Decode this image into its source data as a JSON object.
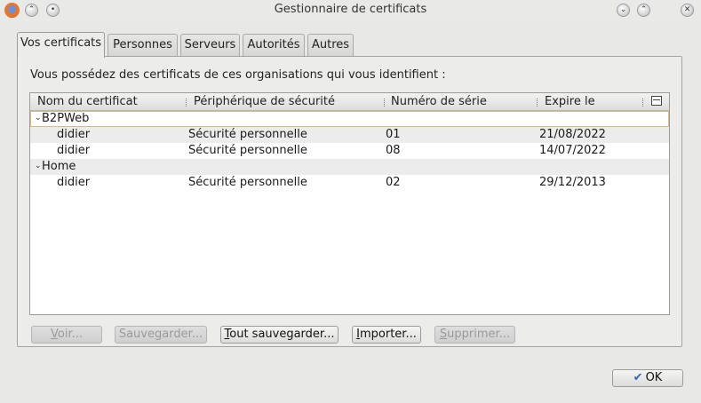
{
  "window": {
    "title": "Gestionnaire de certificats",
    "buttons": {
      "shade": "⌃",
      "sticky": "•",
      "minimize": "⌄",
      "maximize": "⌃",
      "close": "✕"
    }
  },
  "tabs": [
    "Vos certificats",
    "Personnes",
    "Serveurs",
    "Autorités",
    "Autres"
  ],
  "active_tab": "Vos certificats",
  "intro": "Vous possédez des certificats de ces organisations qui vous identifient :",
  "columns": [
    "Nom du certificat",
    "Périphérique de sécurité",
    "Numéro de série",
    "Expire le"
  ],
  "groups": [
    {
      "name": "B2PWeb",
      "rows": [
        {
          "name": "didier",
          "device": "Sécurité personnelle",
          "serial": "01",
          "expires": "21/08/2022"
        },
        {
          "name": "didier",
          "device": "Sécurité personnelle",
          "serial": "08",
          "expires": "14/07/2022"
        }
      ]
    },
    {
      "name": "Home",
      "rows": [
        {
          "name": "didier",
          "device": "Sécurité personnelle",
          "serial": "02",
          "expires": "29/12/2013"
        }
      ]
    }
  ],
  "buttons": {
    "view": {
      "mnemonic": "V",
      "rest": "oir...",
      "enabled": false
    },
    "save": {
      "before": "Sauve",
      "mnemonic": "g",
      "rest": "arder...",
      "enabled": false
    },
    "save_all": {
      "mnemonic": "T",
      "rest": "out sauvegarder...",
      "enabled": true
    },
    "import": {
      "mnemonic": "I",
      "rest": "mporter...",
      "enabled": true
    },
    "delete": {
      "mnemonic": "S",
      "rest": "upprimer...",
      "enabled": false
    },
    "ok": "OK"
  },
  "colors": {
    "focus_border": "#d7b98a",
    "alt_row": "#ececec",
    "ok_check": "#3867b0"
  }
}
